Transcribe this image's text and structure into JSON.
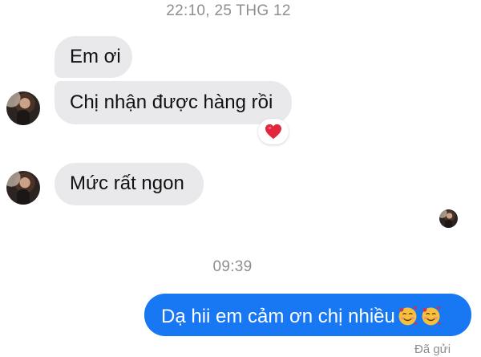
{
  "conversation": {
    "timestamps": [
      "22:10, 25 THG 12",
      "09:39"
    ],
    "messages": [
      {
        "sender": "contact",
        "text": "Em ơi"
      },
      {
        "sender": "contact",
        "text": "Chị nhận được hàng rồi",
        "reaction": "heart-emoji"
      },
      {
        "sender": "contact",
        "text": "Mức rất ngon"
      },
      {
        "sender": "me",
        "text": "Dạ hii em cảm ơn chị nhiều",
        "trailing_emojis": [
          "smiling-face-with-hearts-emoji",
          "smiling-face-with-hearts-emoji"
        ]
      }
    ],
    "status": "Đã gửi"
  },
  "colors": {
    "incoming_bubble": "#e9e9eb",
    "outgoing_bubble": "#1877f2",
    "timestamp_text": "#8e8e93",
    "reaction_heart": "#e3263d"
  }
}
